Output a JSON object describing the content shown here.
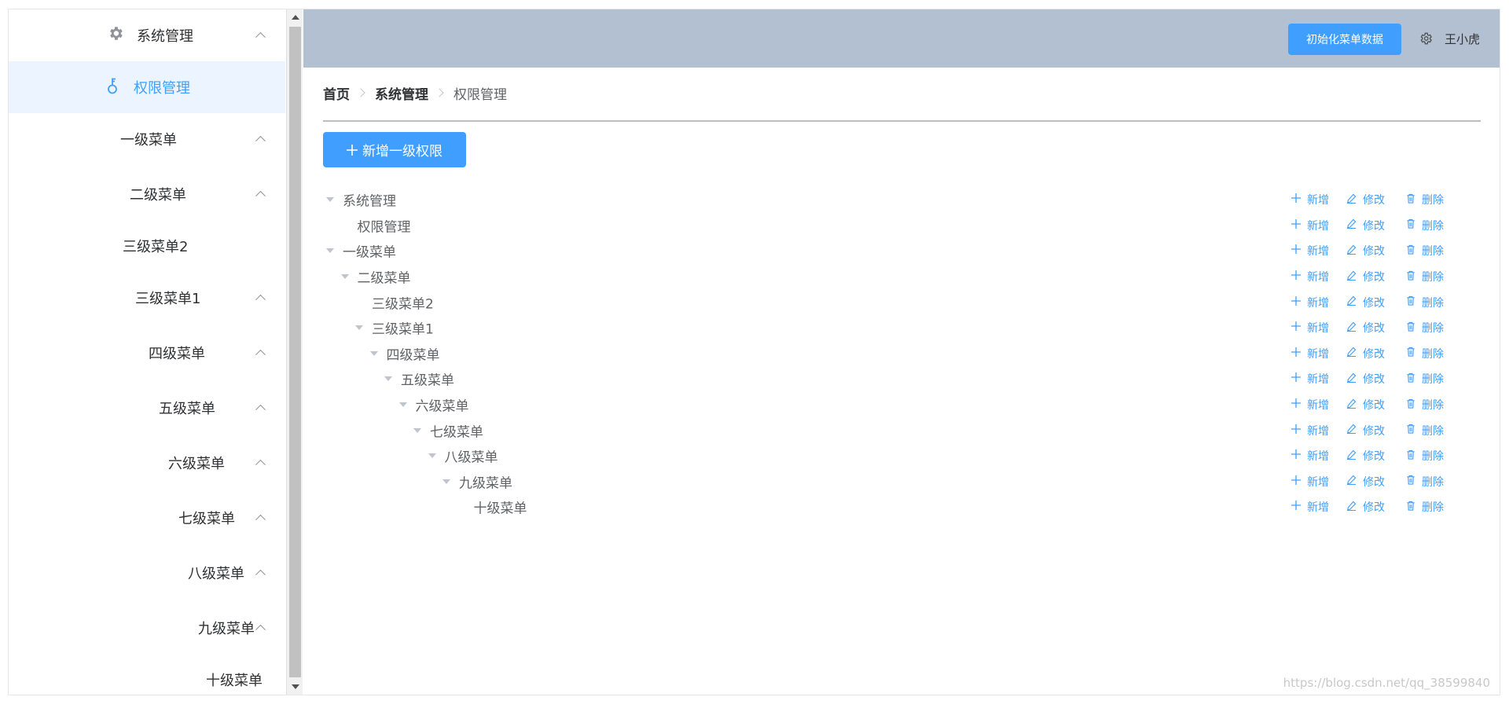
{
  "sidebar": {
    "items": [
      {
        "label": "系统管理",
        "icon": "gear-icon",
        "caret": true,
        "active": false
      },
      {
        "label": "权限管理",
        "icon": "key-icon",
        "caret": false,
        "active": true
      },
      {
        "label": "一级菜单",
        "caret": true
      },
      {
        "label": "二级菜单",
        "caret": true
      },
      {
        "label": "三级菜单2",
        "caret": false
      },
      {
        "label": "三级菜单1",
        "caret": true
      },
      {
        "label": "四级菜单",
        "caret": true
      },
      {
        "label": "五级菜单",
        "caret": true
      },
      {
        "label": "六级菜单",
        "caret": true
      },
      {
        "label": "七级菜单",
        "caret": true
      },
      {
        "label": "八级菜单",
        "caret": true
      },
      {
        "label": "九级菜单",
        "caret": true
      },
      {
        "label": "十级菜单",
        "caret": false
      }
    ]
  },
  "header": {
    "init_button": "初始化菜单数据",
    "username": "王小虎"
  },
  "breadcrumb": [
    "首页",
    "系统管理",
    "权限管理"
  ],
  "add_root_button": "新增一级权限",
  "actions": {
    "add": "新增",
    "edit": "修改",
    "delete": "删除"
  },
  "tree": [
    {
      "label": "系统管理",
      "depth": 0,
      "expandable": true
    },
    {
      "label": "权限管理",
      "depth": 1,
      "expandable": false
    },
    {
      "label": "一级菜单",
      "depth": 0,
      "expandable": true
    },
    {
      "label": "二级菜单",
      "depth": 1,
      "expandable": true
    },
    {
      "label": "三级菜单2",
      "depth": 2,
      "expandable": false
    },
    {
      "label": "三级菜单1",
      "depth": 2,
      "expandable": true
    },
    {
      "label": "四级菜单",
      "depth": 3,
      "expandable": true
    },
    {
      "label": "五级菜单",
      "depth": 4,
      "expandable": true
    },
    {
      "label": "六级菜单",
      "depth": 5,
      "expandable": true
    },
    {
      "label": "七级菜单",
      "depth": 6,
      "expandable": true
    },
    {
      "label": "八级菜单",
      "depth": 7,
      "expandable": true
    },
    {
      "label": "九级菜单",
      "depth": 8,
      "expandable": true
    },
    {
      "label": "十级菜单",
      "depth": 9,
      "expandable": false
    }
  ],
  "watermark": "https://blog.csdn.net/qq_38599840",
  "colors": {
    "accent": "#409eff",
    "header_bg": "#b3c0d1",
    "active_bg": "#ecf5ff"
  }
}
